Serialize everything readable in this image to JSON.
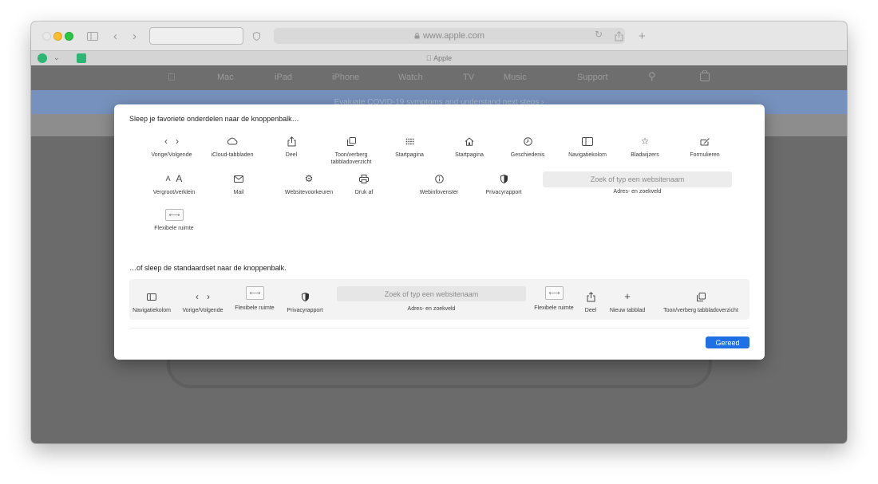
{
  "browser": {
    "address": "www.apple.com",
    "tab_title": "Apple",
    "lock_icon": "lock-icon",
    "colors": {
      "min": "#ffbd2e",
      "max": "#28c940",
      "accent": "#1f6fe5"
    }
  },
  "site": {
    "nav": [
      "Mac",
      "iPad",
      "iPhone",
      "Watch",
      "TV",
      "Music",
      "Support"
    ],
    "banner": "Evaluate COVID-19 symptoms and understand next steps ›"
  },
  "sheet": {
    "title": "Sleep je favoriete onderdelen naar de knoppenbalk…",
    "items_row1": [
      {
        "label": "Vorige/Volgende",
        "icon": "back-forward-icon"
      },
      {
        "label": "iCloud-tabbladen",
        "icon": "cloud-icon"
      },
      {
        "label": "Deel",
        "icon": "share-icon"
      },
      {
        "label": "Toon/verberg tabbladoverzicht",
        "icon": "tab-overview-icon"
      },
      {
        "label": "Startpagina",
        "icon": "grid-icon"
      },
      {
        "label": "Startpagina",
        "icon": "home-icon"
      },
      {
        "label": "Geschiedenis",
        "icon": "clock-icon"
      },
      {
        "label": "Navigatiekolom",
        "icon": "sidebar-icon"
      },
      {
        "label": "Bladwijzers",
        "icon": "star-icon"
      },
      {
        "label": "Formulieren",
        "icon": "autofill-icon"
      }
    ],
    "items_row2": [
      {
        "label": "Vergroot/verklein",
        "icon": "zoom-icon",
        "glyph_small": "A",
        "glyph_big": "A"
      },
      {
        "label": "Mail",
        "icon": "mail-icon"
      },
      {
        "label": "Websitevoorkeuren",
        "icon": "gear-icon"
      },
      {
        "label": "Druk af",
        "icon": "print-icon"
      },
      {
        "label": "Webinfovenster",
        "icon": "info-icon"
      },
      {
        "label": "Privacyrapport",
        "icon": "shield-icon"
      }
    ],
    "search_placeholder": "Zoek of typ een websitenaam",
    "search_label": "Adres- en zoekveld",
    "flexible_space_label": "Flexibele ruimte",
    "default_title": "…of sleep de standaardset naar de knoppenbalk.",
    "default_items": {
      "sidebar": "Navigatiekolom",
      "back_forward": "Vorige/Volgende",
      "flex1": "Flexibele ruimte",
      "privacy": "Privacyrapport",
      "search_placeholder": "Zoek of typ een websitenaam",
      "search_label": "Adres- en zoekveld",
      "flex2": "Flexibele ruimte",
      "share": "Deel",
      "new_tab": "Nieuw tabblad",
      "tab_overview": "Toon/verberg tabbladoverzicht"
    },
    "done_label": "Gereed"
  }
}
